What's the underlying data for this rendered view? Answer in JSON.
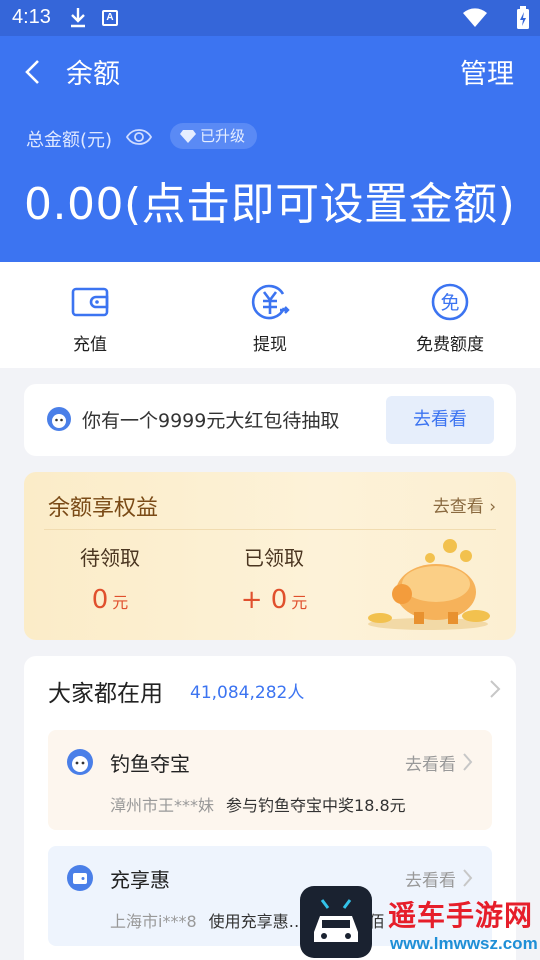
{
  "status_bar": {
    "time": "4:13",
    "icons": [
      "download-icon",
      "a-icon",
      "wifi-icon",
      "battery-icon"
    ]
  },
  "header": {
    "title": "余额",
    "manage_label": "管理"
  },
  "balance": {
    "total_label": "总金额(元)",
    "badge_label": "已升级",
    "amount_text": "0.00(点击即可设置金额)"
  },
  "actions": [
    {
      "label": "充值",
      "icon": "wallet-icon"
    },
    {
      "label": "提现",
      "icon": "yuan-withdraw-icon"
    },
    {
      "label": "免费额度",
      "icon": "free-icon"
    }
  ],
  "promo": {
    "text": "你有一个9999元大红包待抽取",
    "button": "去看看"
  },
  "rights": {
    "title": "余额享权益",
    "link": "去查看",
    "pending": {
      "label": "待领取",
      "value": "0",
      "unit": "元"
    },
    "received": {
      "label": "已领取",
      "value": "+ 0",
      "unit": "元"
    }
  },
  "popular": {
    "title": "大家都在用",
    "count": "41,084,282人",
    "items": [
      {
        "name": "钓鱼夺宝",
        "go": "去看看",
        "who": "漳州市王***妹",
        "desc": "参与钓鱼夺宝中奖18.8元"
      },
      {
        "name": "充享惠",
        "go": "去看看",
        "who": "上海市i***8",
        "desc": "使用充享惠…购物…返佰"
      }
    ]
  },
  "watermark": {
    "cn": "遥车手游网",
    "url": "www.lmwwsz.com"
  },
  "colors": {
    "primary": "#3c74f1",
    "status_bar": "#3566d9",
    "accent_red": "#e0502d",
    "gold_bg": "#fbecc8"
  }
}
